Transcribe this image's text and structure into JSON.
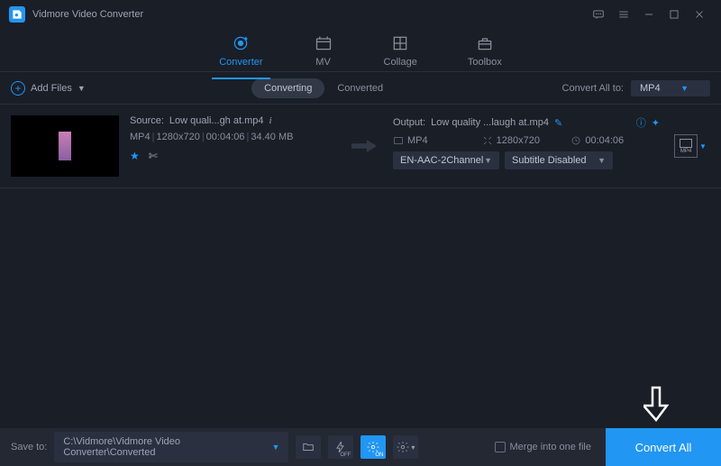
{
  "app": {
    "title": "Vidmore Video Converter"
  },
  "tabs": [
    {
      "label": "Converter",
      "active": true
    },
    {
      "label": "MV",
      "active": false
    },
    {
      "label": "Collage",
      "active": false
    },
    {
      "label": "Toolbox",
      "active": false
    }
  ],
  "toolbar": {
    "add_files": "Add Files",
    "subtabs": {
      "converting": "Converting",
      "converted": "Converted"
    },
    "convert_all_to": "Convert All to:",
    "format": "MP4"
  },
  "item": {
    "source_prefix": "Source:",
    "source_name": "Low quali...gh at.mp4",
    "format": "MP4",
    "resolution": "1280x720",
    "duration": "00:04:06",
    "size": "34.40 MB",
    "output_prefix": "Output:",
    "output_name": "Low quality ...laugh at.mp4",
    "out_format": "MP4",
    "out_resolution": "1280x720",
    "out_duration": "00:04:06",
    "audio_select": "EN-AAC-2Channel",
    "subtitle_select": "Subtitle Disabled",
    "format_tile": "MP4"
  },
  "footer": {
    "save_to": "Save to:",
    "path": "C:\\Vidmore\\Vidmore Video Converter\\Converted",
    "merge": "Merge into one file",
    "convert_all": "Convert All"
  }
}
